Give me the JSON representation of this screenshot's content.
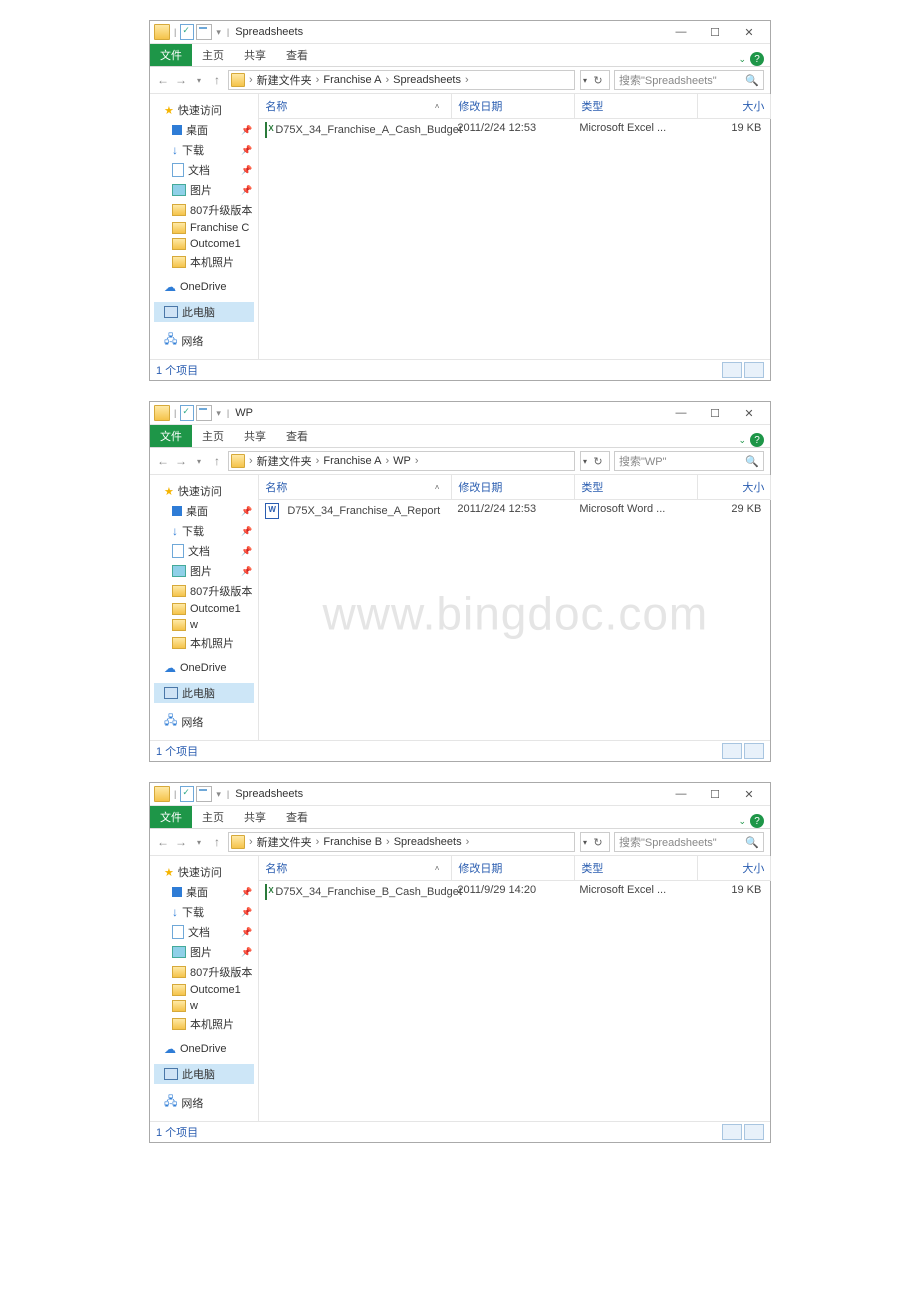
{
  "watermark": "www.bingdoc.com",
  "windows": [
    {
      "title": "Spreadsheets",
      "ribbon": {
        "file": "文件",
        "tabs": [
          "主页",
          "共享",
          "查看"
        ]
      },
      "breadcrumb": [
        "新建文件夹",
        "Franchise A",
        "Spreadsheets"
      ],
      "search_placeholder": "搜索\"Spreadsheets\"",
      "columns": {
        "name": "名称",
        "date": "修改日期",
        "type": "类型",
        "size": "大小"
      },
      "sidebar": {
        "quick": "快速访问",
        "items": [
          {
            "label": "桌面",
            "icon": "blue-sq",
            "pin": true
          },
          {
            "label": "下载",
            "icon": "blue-arrow",
            "pin": true
          },
          {
            "label": "文档",
            "icon": "doc-ico",
            "pin": true
          },
          {
            "label": "图片",
            "icon": "pic-ico",
            "pin": true
          },
          {
            "label": "807升级版本",
            "icon": "fold-ico"
          },
          {
            "label": "Franchise C",
            "icon": "fold-ico"
          },
          {
            "label": "Outcome1",
            "icon": "fold-ico"
          },
          {
            "label": "本机照片",
            "icon": "fold-ico"
          }
        ],
        "onedrive": "OneDrive",
        "thispc": "此电脑",
        "network": "网络"
      },
      "rows": [
        {
          "icon": "excel",
          "name": "D75X_34_Franchise_A_Cash_Budget",
          "date": "2011/2/24 12:53",
          "type": "Microsoft Excel ...",
          "size": "19 KB"
        }
      ],
      "status": "1 个项目",
      "hasWatermark": false
    },
    {
      "title": "WP",
      "ribbon": {
        "file": "文件",
        "tabs": [
          "主页",
          "共享",
          "查看"
        ]
      },
      "breadcrumb": [
        "新建文件夹",
        "Franchise A",
        "WP"
      ],
      "search_placeholder": "搜索\"WP\"",
      "columns": {
        "name": "名称",
        "date": "修改日期",
        "type": "类型",
        "size": "大小"
      },
      "sidebar": {
        "quick": "快速访问",
        "items": [
          {
            "label": "桌面",
            "icon": "blue-sq",
            "pin": true
          },
          {
            "label": "下载",
            "icon": "blue-arrow",
            "pin": true
          },
          {
            "label": "文档",
            "icon": "doc-ico",
            "pin": true
          },
          {
            "label": "图片",
            "icon": "pic-ico",
            "pin": true
          },
          {
            "label": "807升级版本",
            "icon": "fold-ico"
          },
          {
            "label": "Outcome1",
            "icon": "fold-ico"
          },
          {
            "label": "w",
            "icon": "fold-ico"
          },
          {
            "label": "本机照片",
            "icon": "fold-ico"
          }
        ],
        "onedrive": "OneDrive",
        "thispc": "此电脑",
        "network": "网络"
      },
      "rows": [
        {
          "icon": "word",
          "name": "D75X_34_Franchise_A_Report",
          "date": "2011/2/24 12:53",
          "type": "Microsoft Word ...",
          "size": "29 KB"
        }
      ],
      "status": "1 个项目",
      "hasWatermark": true
    },
    {
      "title": "Spreadsheets",
      "ribbon": {
        "file": "文件",
        "tabs": [
          "主页",
          "共享",
          "查看"
        ]
      },
      "breadcrumb": [
        "新建文件夹",
        "Franchise B",
        "Spreadsheets"
      ],
      "search_placeholder": "搜索\"Spreadsheets\"",
      "columns": {
        "name": "名称",
        "date": "修改日期",
        "type": "类型",
        "size": "大小"
      },
      "sidebar": {
        "quick": "快速访问",
        "items": [
          {
            "label": "桌面",
            "icon": "blue-sq",
            "pin": true
          },
          {
            "label": "下载",
            "icon": "blue-arrow",
            "pin": true
          },
          {
            "label": "文档",
            "icon": "doc-ico",
            "pin": true
          },
          {
            "label": "图片",
            "icon": "pic-ico",
            "pin": true
          },
          {
            "label": "807升级版本",
            "icon": "fold-ico"
          },
          {
            "label": "Outcome1",
            "icon": "fold-ico"
          },
          {
            "label": "w",
            "icon": "fold-ico"
          },
          {
            "label": "本机照片",
            "icon": "fold-ico"
          }
        ],
        "onedrive": "OneDrive",
        "thispc": "此电脑",
        "network": "网络"
      },
      "rows": [
        {
          "icon": "excel",
          "name": "D75X_34_Franchise_B_Cash_Budget",
          "date": "2011/9/29 14:20",
          "type": "Microsoft Excel ...",
          "size": "19 KB"
        }
      ],
      "status": "1 个项目",
      "hasWatermark": false
    }
  ]
}
